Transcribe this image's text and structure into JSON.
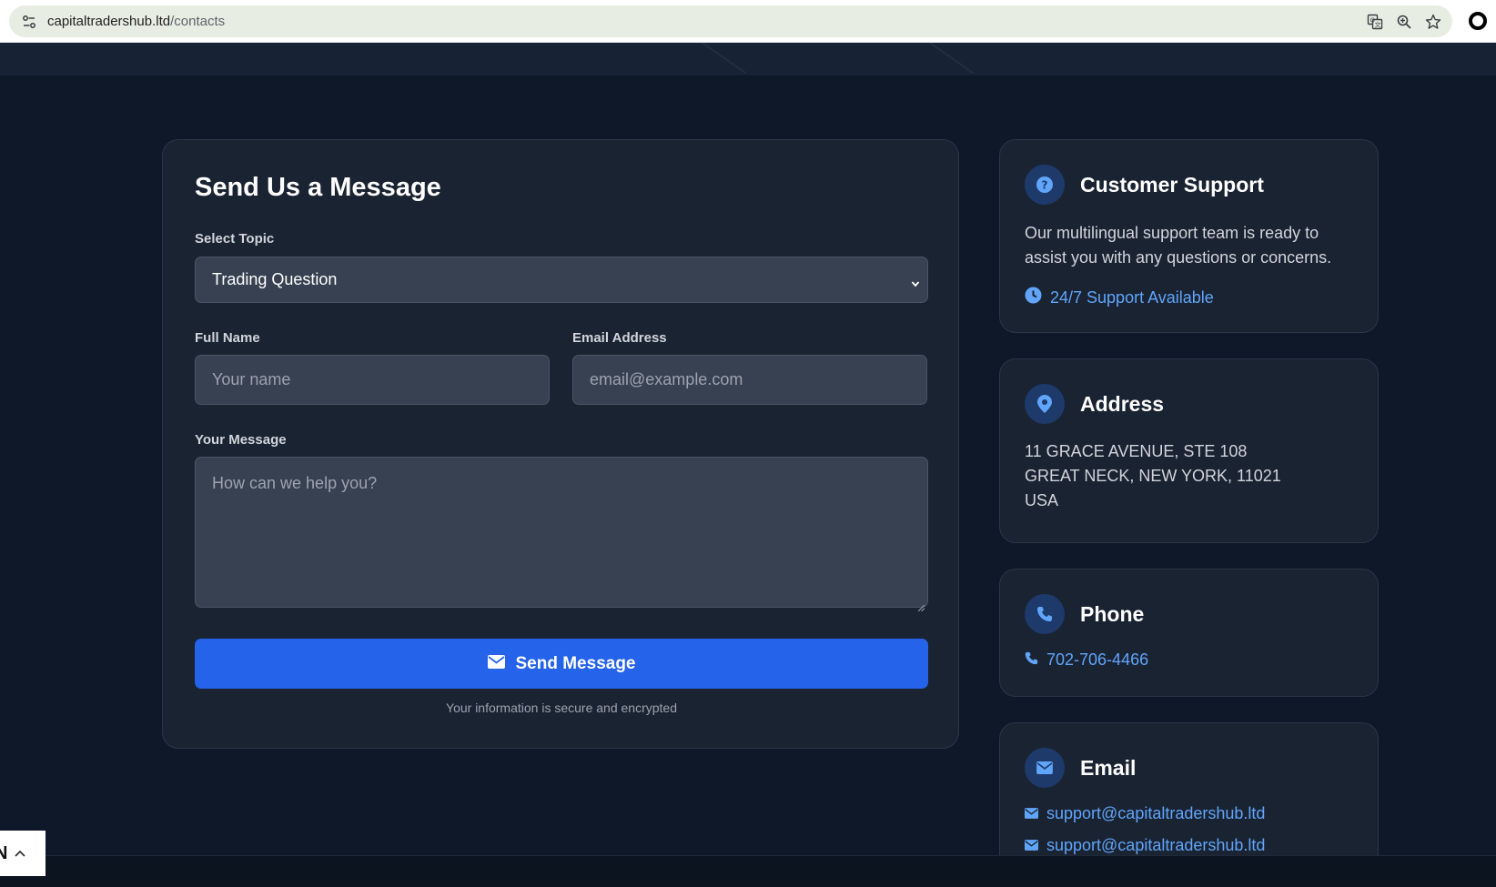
{
  "browser": {
    "url_domain": "capitaltradershub.ltd",
    "url_path": "/contacts"
  },
  "form": {
    "title": "Send Us a Message",
    "topic_label": "Select Topic",
    "topic_value": "Trading Question",
    "name_label": "Full Name",
    "name_placeholder": "Your name",
    "email_label": "Email Address",
    "email_placeholder": "email@example.com",
    "message_label": "Your Message",
    "message_placeholder": "How can we help you?",
    "submit_label": "Send Message",
    "secure_note": "Your information is secure and encrypted"
  },
  "support": {
    "title": "Customer Support",
    "description_line1": "Our multilingual support team is ready to",
    "description_line2": "assist you with any questions or concerns.",
    "availability": "24/7 Support Available"
  },
  "address": {
    "title": "Address",
    "line1": "11 GRACE AVENUE, STE 108",
    "line2": "GREAT NECK, NEW YORK, 11021",
    "line3": "USA"
  },
  "phone": {
    "title": "Phone",
    "number": "702-706-4466"
  },
  "email": {
    "title": "Email",
    "addresses": [
      "support@capitaltradershub.ltd",
      "support@capitaltradershub.ltd"
    ]
  },
  "language_widget": {
    "code": "N"
  },
  "colors": {
    "accent": "#2563eb",
    "link": "#60a5fa",
    "background": "#0f1828",
    "card": "#1a2332"
  },
  "icons": {
    "site_settings": "site-settings-icon",
    "translate": "translate-icon",
    "zoom": "zoom-icon",
    "bookmark": "star-icon",
    "support": "question-icon",
    "clock": "clock-icon",
    "address": "map-pin-icon",
    "phone": "phone-icon",
    "email": "envelope-icon",
    "chevron": "chevron-up-icon"
  }
}
